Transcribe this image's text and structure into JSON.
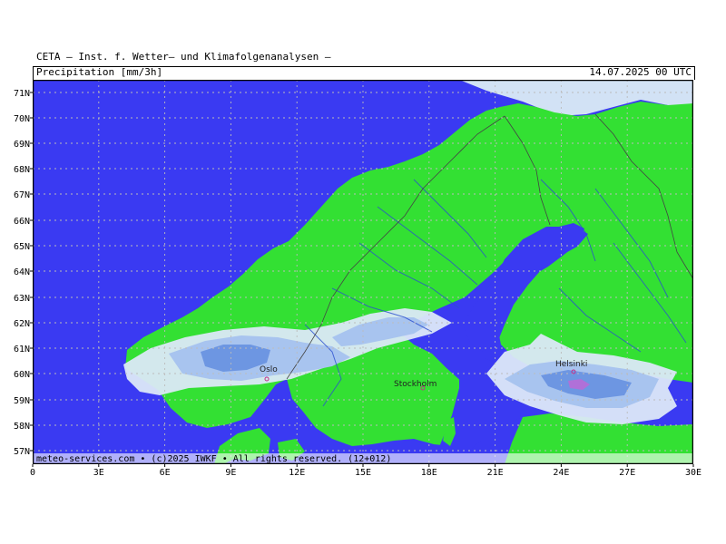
{
  "header": {
    "title": "CETA – Inst. f. Wetter– und Klimafolgenanalysen –",
    "variable": "Precipitation [mm/3h]",
    "datetime": "14.07.2025 00 UTC"
  },
  "footer": {
    "credit": "meteo-services.com • (c)2025 IWKF • All rights reserved. (12+012)"
  },
  "axes": {
    "lat_labels": [
      "71N",
      "70N",
      "69N",
      "68N",
      "67N",
      "66N",
      "65N",
      "64N",
      "63N",
      "62N",
      "61N",
      "60N",
      "59N",
      "58N",
      "57N"
    ],
    "lon_labels": [
      "0",
      "3E",
      "6E",
      "9E",
      "12E",
      "15E",
      "18E",
      "21E",
      "24E",
      "27E",
      "30E"
    ]
  },
  "cities": [
    {
      "name": "Oslo",
      "lon": 10.75,
      "lat": 59.9
    },
    {
      "name": "Stockholm",
      "lon": 18.0,
      "lat": 59.3
    },
    {
      "name": "Helsinki",
      "lon": 24.9,
      "lat": 60.2
    }
  ],
  "colors": {
    "sea": "#3a3af2",
    "land": "#33e033",
    "ice_land": "#d2e2f5",
    "precip_light": "#dce8f8",
    "precip_mid": "#a8c4ef",
    "precip_heavy": "#6d96e2",
    "precip_max": "#b070d8",
    "grid": "#aaaaaa",
    "borders": "#444444",
    "rivers": "#2a4fcf"
  }
}
